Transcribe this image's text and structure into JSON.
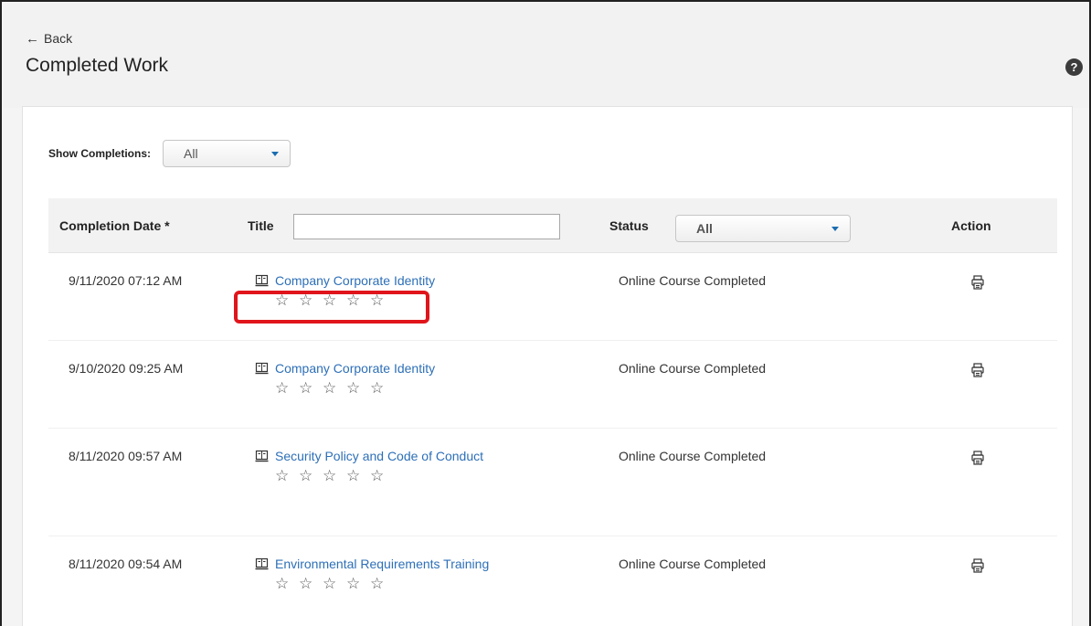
{
  "header": {
    "back_label": "Back",
    "title": "Completed Work",
    "help_icon": "?"
  },
  "filter": {
    "label": "Show Completions:",
    "selected": "All"
  },
  "table": {
    "columns": {
      "date": "Completion Date *",
      "title": "Title",
      "status": "Status",
      "action": "Action"
    },
    "title_filter_value": "",
    "status_filter_selected": "All",
    "rows": [
      {
        "date": "9/11/2020 07:12 AM",
        "title": "Company Corporate Identity",
        "status": "Online Course Completed",
        "rating": 0
      },
      {
        "date": "9/10/2020 09:25 AM",
        "title": "Company Corporate Identity",
        "status": "Online Course Completed",
        "rating": 0
      },
      {
        "date": "8/11/2020 09:57 AM",
        "title": "Security Policy and Code of Conduct",
        "status": "Online Course Completed",
        "rating": 0
      },
      {
        "date": "8/11/2020 09:54 AM",
        "title": "Environmental Requirements Training",
        "status": "Online Course Completed",
        "rating": 0
      }
    ]
  },
  "colors": {
    "link": "#2d6fb7",
    "highlight": "#e0151b",
    "caret": "#1a6db1"
  },
  "icons": {
    "course": "online-course-icon",
    "print": "print-icon",
    "star": "star-outline-icon"
  },
  "highlight": {
    "target_row": 0
  }
}
